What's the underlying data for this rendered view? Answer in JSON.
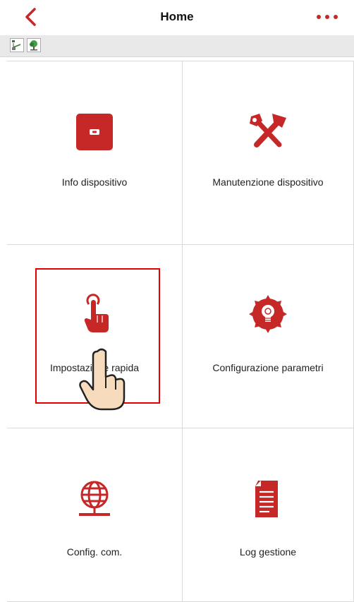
{
  "header": {
    "title": "Home",
    "back_icon": "chevron-left-icon",
    "more_icon": "more-dots-icon"
  },
  "status_icons": [
    "network-topology-icon",
    "tree-monitor-icon"
  ],
  "tiles": [
    {
      "label": "Info dispositivo",
      "icon": "device-info-icon"
    },
    {
      "label": "Manutenzione dispositivo",
      "icon": "tools-icon"
    },
    {
      "label": "Impostazione rapida",
      "icon": "tap-hand-icon"
    },
    {
      "label": "Configurazione parametri",
      "icon": "settings-bulb-icon"
    },
    {
      "label": "Config. com.",
      "icon": "network-globe-icon"
    },
    {
      "label": "Log gestione",
      "icon": "document-log-icon"
    }
  ],
  "colors": {
    "accent": "#c62828",
    "highlight_box": "#e40000",
    "grid_line": "#dadada",
    "status_bar": "#e9e9e9"
  }
}
